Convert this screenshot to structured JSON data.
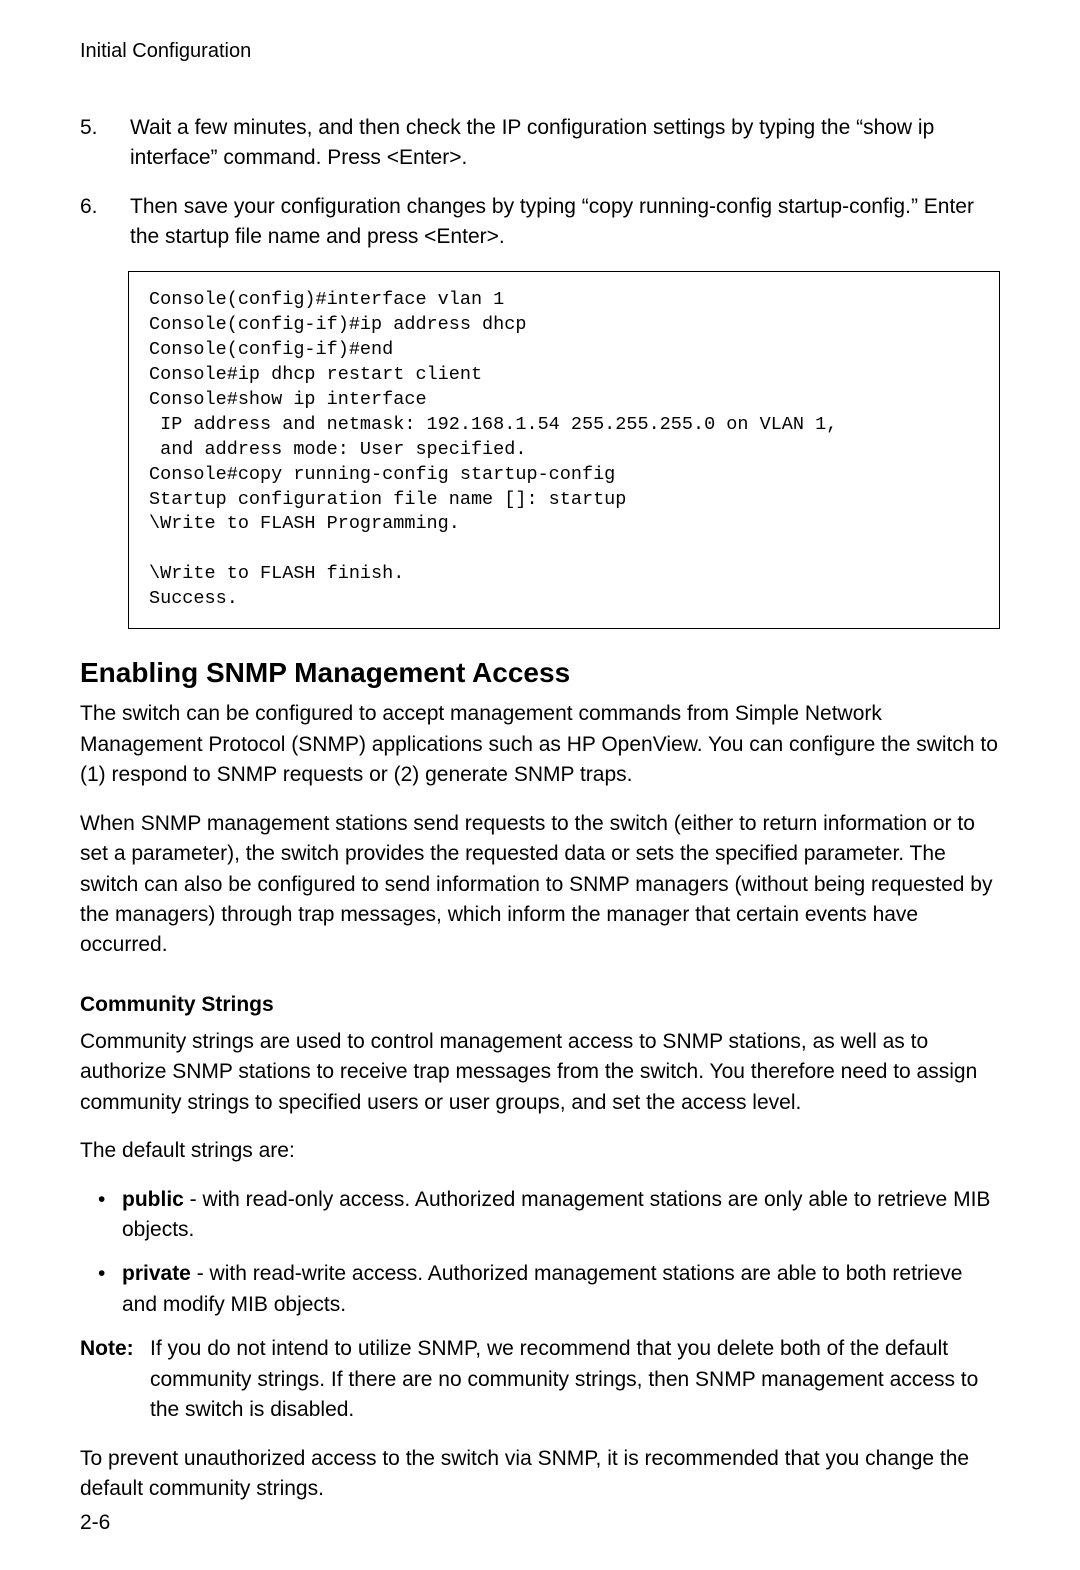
{
  "header": "Initial Configuration",
  "steps": [
    {
      "num": "5.",
      "text": "Wait a few minutes, and then check the IP configuration settings by typing the “show ip interface” command. Press <Enter>."
    },
    {
      "num": "6.",
      "text": "Then save your configuration changes by typing “copy running-config startup-config.” Enter the startup file name and press <Enter>."
    }
  ],
  "code_block": "Console(config)#interface vlan 1\nConsole(config-if)#ip address dhcp\nConsole(config-if)#end\nConsole#ip dhcp restart client\nConsole#show ip interface\n IP address and netmask: 192.168.1.54 255.255.255.0 on VLAN 1,\n and address mode: User specified.\nConsole#copy running-config startup-config\nStartup configuration file name []: startup\n\\Write to FLASH Programming.\n\n\\Write to FLASH finish.\nSuccess.",
  "section_heading": "Enabling SNMP Management Access",
  "snmp_para1": "The switch can be configured to accept management commands from Simple Network Management Protocol (SNMP) applications such as HP OpenView. You can configure the switch to (1) respond to SNMP requests or (2) generate SNMP traps.",
  "snmp_para2": "When SNMP management stations send requests to the switch (either to return information or to set a parameter), the switch provides the requested data or sets the specified parameter. The switch can also be configured to send information to SNMP managers (without being requested by the managers) through trap messages, which inform the manager that certain events have occurred.",
  "subheading": "Community Strings",
  "cs_para1": "Community strings are used to control management access to SNMP stations, as well as to authorize SNMP stations to receive trap messages from the switch. You therefore need to assign community strings to specified users or user groups, and set the access level.",
  "cs_para2": "The default strings are:",
  "bullets": [
    {
      "bold": "public",
      "rest": " - with read-only access. Authorized management stations are only able to retrieve MIB objects."
    },
    {
      "bold": "private",
      "rest": " - with read-write access. Authorized management stations are able to both retrieve and modify MIB objects."
    }
  ],
  "note": {
    "label": "Note:",
    "text": "If you do not intend to utilize SNMP, we recommend that you delete both of the default community strings. If there are no community strings, then SNMP management access to the switch is disabled."
  },
  "final_para": "To prevent unauthorized access to the switch via SNMP, it is recommended that you change the default community strings.",
  "page_number": "2-6"
}
